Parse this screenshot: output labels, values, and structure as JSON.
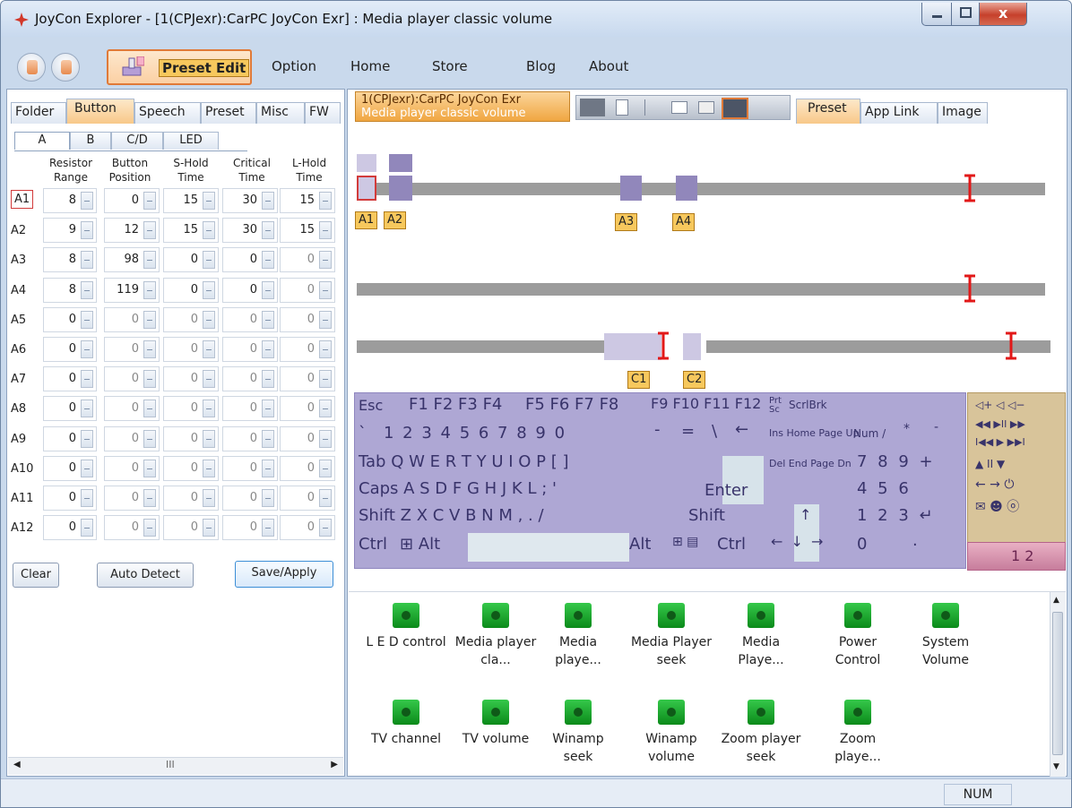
{
  "window": {
    "title": "JoyCon Explorer - [1(CPJexr):CarPC JoyCon Exr] : Media player classic volume"
  },
  "toolbar": {
    "preset_edit": "Preset Edit",
    "menu": [
      "Option",
      "Home",
      "Store",
      "Blog",
      "About"
    ]
  },
  "left": {
    "tabs": [
      "Folder",
      "Button",
      "Speech",
      "Preset",
      "Misc",
      "FW"
    ],
    "selected_tab": "Button",
    "subtabs": [
      "A",
      "B",
      "C/D",
      "LED"
    ],
    "headers": [
      "Resistor Range",
      "Button Position",
      "S-Hold Time",
      "Critical Time",
      "L-Hold Time"
    ],
    "rows": [
      {
        "label": "A1",
        "values": [
          "8",
          "0",
          "15",
          "30",
          "15"
        ]
      },
      {
        "label": "A2",
        "values": [
          "9",
          "12",
          "15",
          "30",
          "15"
        ]
      },
      {
        "label": "A3",
        "values": [
          "8",
          "98",
          "0",
          "0",
          "0"
        ]
      },
      {
        "label": "A4",
        "values": [
          "8",
          "119",
          "0",
          "0",
          "0"
        ]
      },
      {
        "label": "A5",
        "values": [
          "0",
          "0",
          "0",
          "0",
          "0"
        ]
      },
      {
        "label": "A6",
        "values": [
          "0",
          "0",
          "0",
          "0",
          "0"
        ]
      },
      {
        "label": "A7",
        "values": [
          "0",
          "0",
          "0",
          "0",
          "0"
        ]
      },
      {
        "label": "A8",
        "values": [
          "0",
          "0",
          "0",
          "0",
          "0"
        ]
      },
      {
        "label": "A9",
        "values": [
          "0",
          "0",
          "0",
          "0",
          "0"
        ]
      },
      {
        "label": "A10",
        "values": [
          "0",
          "0",
          "0",
          "0",
          "0"
        ]
      },
      {
        "label": "A11",
        "values": [
          "0",
          "0",
          "0",
          "0",
          "0"
        ]
      },
      {
        "label": "A12",
        "values": [
          "0",
          "0",
          "0",
          "0",
          "0"
        ]
      }
    ],
    "buttons": {
      "clear": "Clear",
      "auto_detect": "Auto Detect",
      "save_apply": "Save/Apply"
    },
    "scroll_mark": "III"
  },
  "right": {
    "device_tab_line1": "1(CPJexr):CarPC JoyCon Exr",
    "device_tab_line2": "Media player classic volume",
    "tabs": [
      "Preset",
      "App Link",
      "Image"
    ],
    "selected_tab": "Preset",
    "markers": [
      "A1",
      "A2",
      "A3",
      "A4",
      "C1",
      "C2"
    ],
    "keyboard": {
      "row1": [
        "Esc",
        "F1 F2 F3 F4",
        "F5 F6 F7 F8",
        "F9 F10 F11 F12",
        "Prt Sc",
        "ScrlBrk"
      ],
      "row2": [
        "`",
        "1 2 3 4 5 6 7 8 9 0",
        "-",
        "=",
        "\\",
        "←",
        "Ins Home Page Up",
        "Num /",
        "*",
        "-"
      ],
      "row3": [
        "Tab Q W E R T Y U I O P [ ]",
        "Del End Page Dn",
        "7 8 9 +"
      ],
      "row4": [
        "Caps A S D F G H J K L ; '",
        "Enter",
        "4 5 6"
      ],
      "row5": [
        "Shift Z X C V B N M , . /",
        "Shift",
        "↑",
        "1 2 3 ↵"
      ],
      "row6": [
        "Ctrl",
        "⊞ Alt",
        "Alt",
        "⊞ ▤",
        "Ctrl",
        "← ↓ →",
        "0",
        "."
      ],
      "pad": [
        "◁+ ◁ ◁−",
        "◀◀ ▶II ▶▶",
        "I◀◀ ▶ ▶▶I",
        "▲ II ▼",
        "← → ⏻",
        "✉ ☻ ⓞ"
      ],
      "pad_bottom": "1 2"
    },
    "presets": [
      "L E D control",
      "Media player cla...",
      "Media playe...",
      "Media Player seek",
      "Media Playe...",
      "Power Control",
      "System Volume",
      "TV channel",
      "TV volume",
      "Winamp seek",
      "Winamp volume",
      "Zoom player seek",
      "Zoom playe..."
    ]
  },
  "status": {
    "num": "NUM"
  }
}
